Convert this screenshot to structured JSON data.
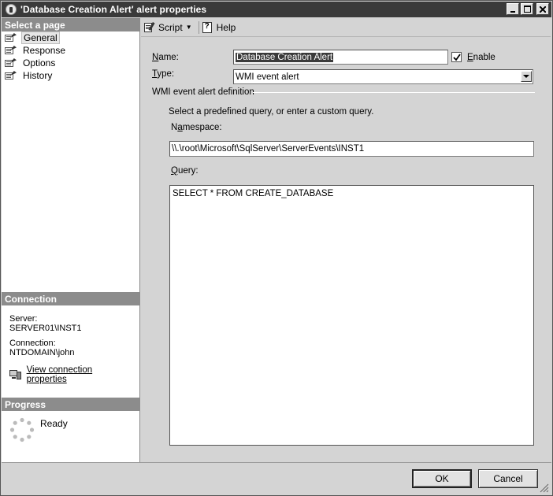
{
  "window": {
    "title": "'Database Creation Alert' alert properties",
    "controls": {
      "minimize": "_",
      "maximize": "□",
      "close": "X"
    }
  },
  "left_panel": {
    "select_page_header": "Select a page",
    "pages": [
      {
        "label": "General",
        "icon": "page-icon",
        "selected": true
      },
      {
        "label": "Response",
        "icon": "page-icon",
        "selected": false
      },
      {
        "label": "Options",
        "icon": "page-icon",
        "selected": false
      },
      {
        "label": "History",
        "icon": "page-icon",
        "selected": false
      }
    ],
    "connection": {
      "header": "Connection",
      "server_label": "Server:",
      "server_value": "SERVER01\\INST1",
      "connection_label": "Connection:",
      "connection_value": "NTDOMAIN\\john",
      "view_link": "View connection properties"
    },
    "progress": {
      "header": "Progress",
      "status": "Ready"
    }
  },
  "toolbar": {
    "script_label": "Script",
    "help_label": "Help"
  },
  "general": {
    "name_label": "Name:",
    "name_value": "Database Creation Alert",
    "enable_label": "Enable",
    "enable_checked": true,
    "type_label": "Type:",
    "type_value": "WMI event alert",
    "wmi_section_title": "WMI event alert definition",
    "instructions": "Select a predefined query, or enter a custom query.",
    "namespace_label": "Namespace:",
    "namespace_value": "\\\\.\\root\\Microsoft\\SqlServer\\ServerEvents\\INST1",
    "query_label": "Query:",
    "query_value": "SELECT * FROM CREATE_DATABASE"
  },
  "buttons": {
    "ok_label": "OK",
    "cancel_label": "Cancel"
  }
}
